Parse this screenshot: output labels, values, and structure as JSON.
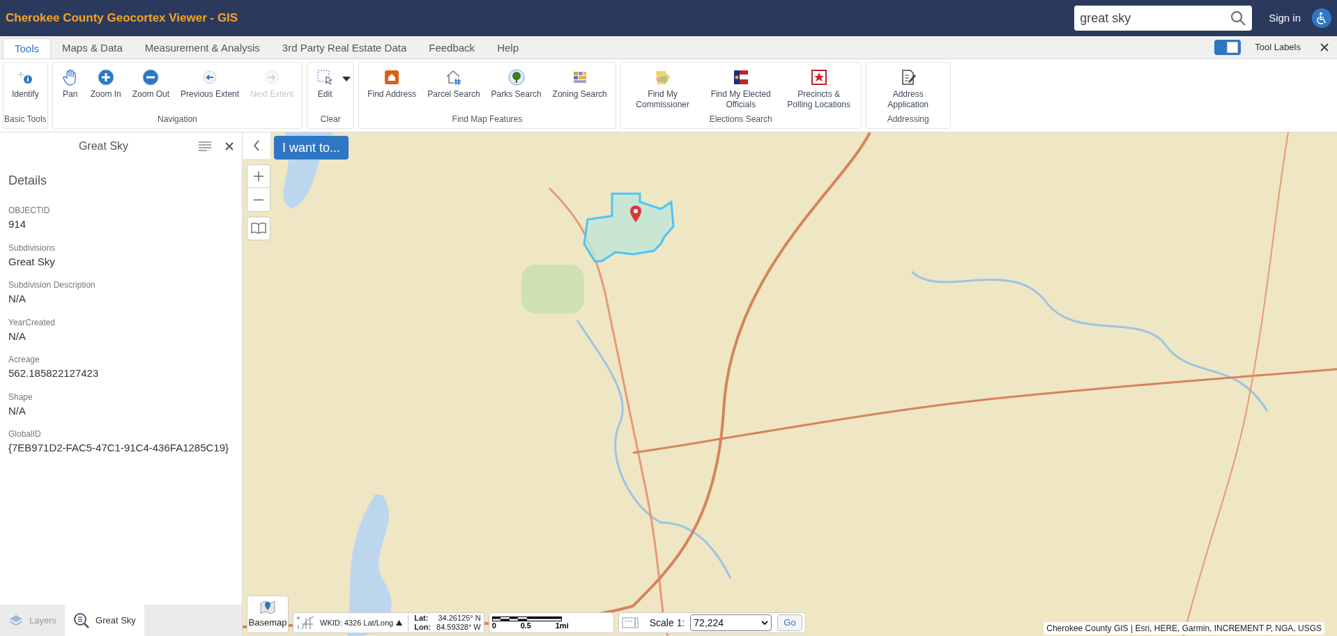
{
  "header": {
    "title": "Cherokee County Geocortex Viewer - GIS",
    "search": {
      "value": "great sky"
    },
    "sign_in": "Sign in"
  },
  "tabs": [
    {
      "label": "Tools",
      "selected": true
    },
    {
      "label": "Maps & Data",
      "selected": false
    },
    {
      "label": "Measurement & Analysis",
      "selected": false
    },
    {
      "label": "3rd Party Real Estate Data",
      "selected": false
    },
    {
      "label": "Feedback",
      "selected": false
    },
    {
      "label": "Help",
      "selected": false
    }
  ],
  "tool_labels": {
    "label": "Tool Labels",
    "checked": true
  },
  "ribbon": [
    {
      "label": "Basic Tools",
      "tools": [
        {
          "label": "Identify",
          "kind": "identify",
          "disabled": false
        }
      ]
    },
    {
      "label": "Navigation",
      "tools": [
        {
          "label": "Pan",
          "kind": "pan",
          "disabled": false
        },
        {
          "label": "Zoom In",
          "kind": "zoomin",
          "disabled": false
        },
        {
          "label": "Zoom Out",
          "kind": "zoomout",
          "disabled": false
        },
        {
          "label": "Previous Extent",
          "kind": "previous",
          "disabled": false
        },
        {
          "label": "Next Extent",
          "kind": "next",
          "disabled": true
        }
      ]
    },
    {
      "label": "Clear",
      "tools": [
        {
          "label": "Edit",
          "kind": "edit",
          "disabled": false
        }
      ]
    },
    {
      "label": "Find Map Features",
      "tools": [
        {
          "label": "Find Address",
          "kind": "address",
          "disabled": false
        },
        {
          "label": "Parcel Search",
          "kind": "parcel",
          "disabled": false
        },
        {
          "label": "Parks Search",
          "kind": "parks",
          "disabled": false
        },
        {
          "label": "Zoning Search",
          "kind": "zoning",
          "disabled": false
        }
      ]
    },
    {
      "label": "Elections Search",
      "tools": [
        {
          "label": "Find My Commissioner",
          "kind": "commissioner",
          "disabled": false
        },
        {
          "label": "Find My Elected Officials",
          "kind": "officials",
          "disabled": false
        },
        {
          "label": "Precincts & Polling Locations",
          "kind": "precincts",
          "disabled": false
        }
      ]
    },
    {
      "label": "Addressing",
      "tools": [
        {
          "label": "Address Application",
          "kind": "application",
          "disabled": false
        }
      ]
    }
  ],
  "panel": {
    "title": "Great Sky",
    "heading": "Details",
    "fields": [
      {
        "label": "OBJECTID",
        "value": "914"
      },
      {
        "label": "Subdivisions",
        "value": "Great Sky"
      },
      {
        "label": "Subdivision Description",
        "value": "N/A"
      },
      {
        "label": "YearCreated",
        "value": "N/A"
      },
      {
        "label": "Acreage",
        "value": "562.185822127423"
      },
      {
        "label": "Shape",
        "value": "N/A"
      },
      {
        "label": "GlobalID",
        "value": "{7EB971D2-FAC5-47C1-91C4-436FA1285C19}"
      }
    ],
    "bottom_tabs": [
      {
        "label": "Layers",
        "selected": false
      },
      {
        "label": "Great Sky",
        "selected": true
      }
    ]
  },
  "map": {
    "i_want_to": "I want to...",
    "basemap": "Basemap",
    "wkid": "WKID: 4326 Lat/Long",
    "lat_label": "Lat:",
    "lat": "34.26125° N",
    "lon_label": "Lon:",
    "lon": "84.59328° W",
    "scale_ticks": [
      "0",
      "0.5",
      "1mi"
    ],
    "scale_label": "Scale 1:",
    "scale_value": "72,224",
    "go": "Go",
    "attribution": "Cherokee County GIS | Esri, HERE, Garmin, INCREMENT P, NGA, USGS"
  }
}
